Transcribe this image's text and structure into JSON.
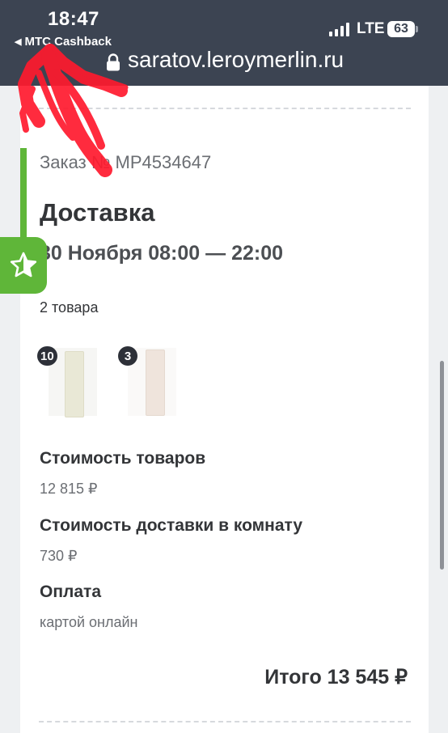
{
  "status_bar": {
    "time": "18:47",
    "back_app": "МТС Cashback",
    "network": "LTE",
    "battery": "63"
  },
  "browser": {
    "url": "saratov.leroymerlin.ru"
  },
  "order": {
    "number": "Заказ № МР4534647",
    "delivery_title": "Доставка",
    "delivery_date": "30 Ноября 08:00 — 22:00",
    "goods_count": "2 товара",
    "items": [
      {
        "qty": "10"
      },
      {
        "qty": "3"
      }
    ],
    "goods_cost_label": "Стоимость товаров",
    "goods_cost_value": "12 815 ₽",
    "delivery_cost_label": "Стоимость доставки в комнату",
    "delivery_cost_value": "730 ₽",
    "payment_label": "Оплата",
    "payment_value": "картой онлайн",
    "total": "Итого 13 545 ₽"
  },
  "colors": {
    "accent_green": "#5fb639",
    "header_bg": "#3c4452",
    "annotation_red": "#ff1a2e"
  },
  "icons": {
    "favorite": "star-icon",
    "secure": "lock-icon"
  }
}
